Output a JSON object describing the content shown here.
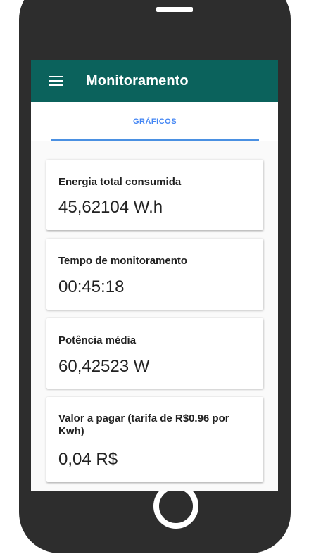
{
  "app": {
    "title": "Monitoramento",
    "header_color": "#0b625c"
  },
  "tabs": [
    {
      "label": "GRÁFICOS",
      "active": true
    }
  ],
  "cards": [
    {
      "label": "Energia total consumida",
      "value": "45,62104 W.h"
    },
    {
      "label": "Tempo de monitoramento",
      "value": "00:45:18"
    },
    {
      "label": "Potência média",
      "value": "60,42523 W"
    },
    {
      "label": "Valor a pagar (tarifa de R$0.96 por Kwh)",
      "value": "0,04 R$"
    }
  ],
  "icons": {
    "menu": "hamburger-menu-icon",
    "home": "home-button-circle"
  }
}
